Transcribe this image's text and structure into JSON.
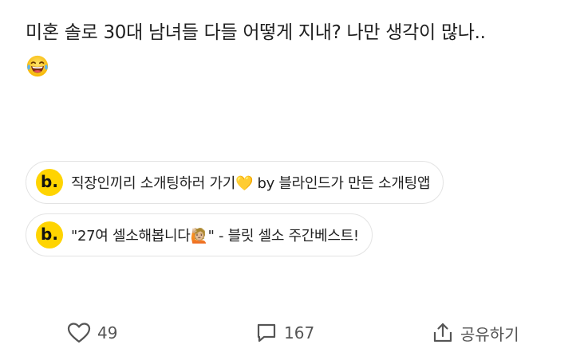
{
  "post": {
    "text": "미혼 솔로 30대 남녀들 다들 어떻게 지내? 나만 생각이 많나..",
    "emoji": "laughing-tears-emoji"
  },
  "links": [
    {
      "logo": "b.",
      "label": "직장인끼리 소개팅하러 가기💛 by 블라인드가 만든 소개팅앱"
    },
    {
      "logo": "b.",
      "label": "\"27여 셀소해봅니다🙋🏼\" - 블릿 셀소 주간베스트!"
    }
  ],
  "actions": {
    "like_count": "49",
    "comment_count": "167",
    "share_label": "공유하기"
  },
  "colors": {
    "brand_yellow": "#ffd400",
    "chip_border": "#e3e3e3",
    "icon_gray": "#555555"
  }
}
